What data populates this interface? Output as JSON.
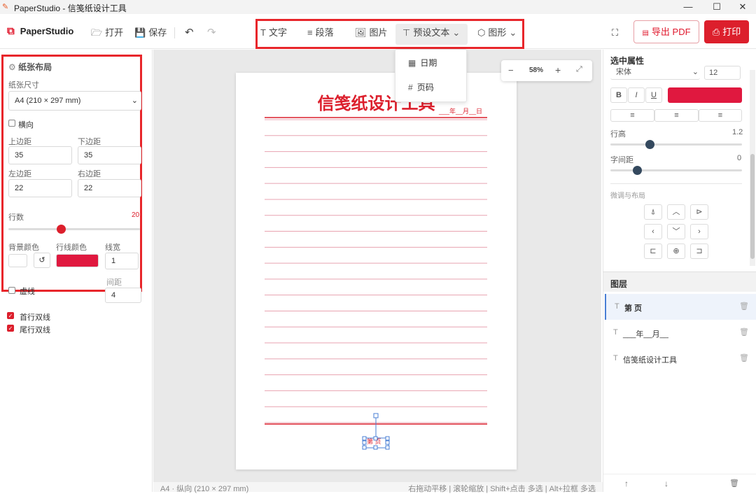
{
  "window": {
    "title": "PaperStudio - 信笺纸设计工具",
    "minimize_glyph": "—",
    "maximize_glyph": "☐",
    "close_glyph": "✕"
  },
  "toolbar": {
    "app_name": "PaperStudio",
    "open_label": "打开",
    "save_label": "保存",
    "tools": {
      "text_label": "文字",
      "paragraph_label": "段落",
      "image_label": "图片",
      "presets_label": "预设文本",
      "shapes_label": "图形"
    },
    "export_pdf_label": "导出 PDF",
    "print_label": "打印"
  },
  "presets_menu": {
    "items": [
      {
        "label": "日期",
        "icon": "calendar-icon"
      },
      {
        "label": "页码",
        "icon": "hash-icon"
      }
    ]
  },
  "left_panel": {
    "section_title": "纸张布局",
    "paper_size_label": "纸张尺寸",
    "paper_size_value": "A4 (210 × 297 mm)",
    "landscape_label": "横向",
    "landscape_checked": false,
    "top_margin_label": "上边距",
    "top_margin_value": "35",
    "bottom_margin_label": "下边距",
    "bottom_margin_value": "35",
    "left_margin_label": "左边距",
    "left_margin_value": "22",
    "right_margin_label": "右边距",
    "right_margin_value": "22",
    "rows_label": "行数",
    "rows_value": "20",
    "rows_slider_fraction": 0.4,
    "bg_color_label": "背景颜色",
    "bg_color": "#ffffff",
    "line_color_label": "行线颜色",
    "line_color": "#e0183f",
    "line_width_label": "线宽",
    "line_width_value": "1",
    "dashed_label": "虚线",
    "spacing_label": "间距",
    "spacing_value": "4",
    "first_double_label": "首行双线",
    "first_double_checked": true,
    "last_double_label": "尾行双线",
    "last_double_checked": true
  },
  "canvas": {
    "zoom_value": "58%",
    "zoom_minus": "−",
    "zoom_plus": "+",
    "paper_title": "信笺纸设计工具",
    "date_text": "___年__月__日",
    "page_text": "第 页",
    "line_count": 20,
    "accent": "#dc1f2c",
    "line_color": "#e8a3b0"
  },
  "status": {
    "left": "A4 · 纵向 (210 × 297 mm)",
    "right": "右拖动平移 | 滚轮缩放 | Shift+点击 多选 | Alt+拉框 多选"
  },
  "right_panel": {
    "section_title": "选中属性",
    "font_value": "宋体",
    "font_size_value": "12",
    "bold_label": "B",
    "italic_label": "I",
    "underline_label": "U",
    "text_color": "#e0183f",
    "line_height_label": "行高",
    "line_height_value": "1.2",
    "line_height_fraction": 0.3,
    "letter_spacing_label": "字间距",
    "letter_spacing_value": "0",
    "letter_spacing_fraction": 0.2,
    "fine_tune_label": "微调与布局",
    "layers_title": "图层",
    "layers": [
      {
        "name": "第 页",
        "selected": true
      },
      {
        "name": "___年__月__",
        "selected": false
      },
      {
        "name": "信笺纸设计工具",
        "selected": false
      }
    ]
  }
}
